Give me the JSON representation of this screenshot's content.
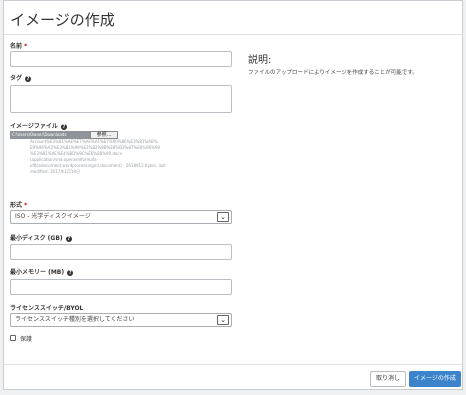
{
  "dialog": {
    "title": "イメージの作成"
  },
  "fields": {
    "name_label": "名前",
    "required_mark": "*",
    "tags_label": "タグ",
    "file_label": "イメージファイル",
    "format_label": "形式",
    "format_value": "ISO - 光学ディスクイメージ",
    "min_disk_label": "最小ディスク (GB)",
    "min_ram_label": "最小メモリー (MB)",
    "license_label": "ライセンススイッチ/BYOL",
    "license_value": "ライセンススイッチ種別を選択してください",
    "protected_label": "保護"
  },
  "file": {
    "chosen": "C:\\Users\\Owner\\Downloads",
    "browse_label": "参照...",
    "path_line1": "Account%E3%81%AE%E7%AE%A1%E7%90%86%E3%81%AB%",
    "path_line2": "E9%96%A2%E3%81%99%E3%82%8B%E8%B3%87%E6%96%99",
    "path_line3": "%E3%81%AE%E4%BD%9C%E6%88%90.docx",
    "path_line4": "(application/vnd.openxmlformats-",
    "path_line5": "officedocument.wordprocessingml.document) - 2618912 bytes, last",
    "path_line6": "modified: 2017年1月19日"
  },
  "description": {
    "title": "説明:",
    "text": "ファイルのアップロードによりイメージを作成することが可能です。"
  },
  "footer": {
    "cancel_label": "取り消し",
    "create_label": "イメージの作成"
  },
  "icons": {
    "help": "question-circle-icon",
    "dropdown": "chevron-down-icon",
    "checkbox": "checkbox-icon"
  },
  "colors": {
    "primary": "#3b84cc",
    "required": "#cc0000"
  }
}
